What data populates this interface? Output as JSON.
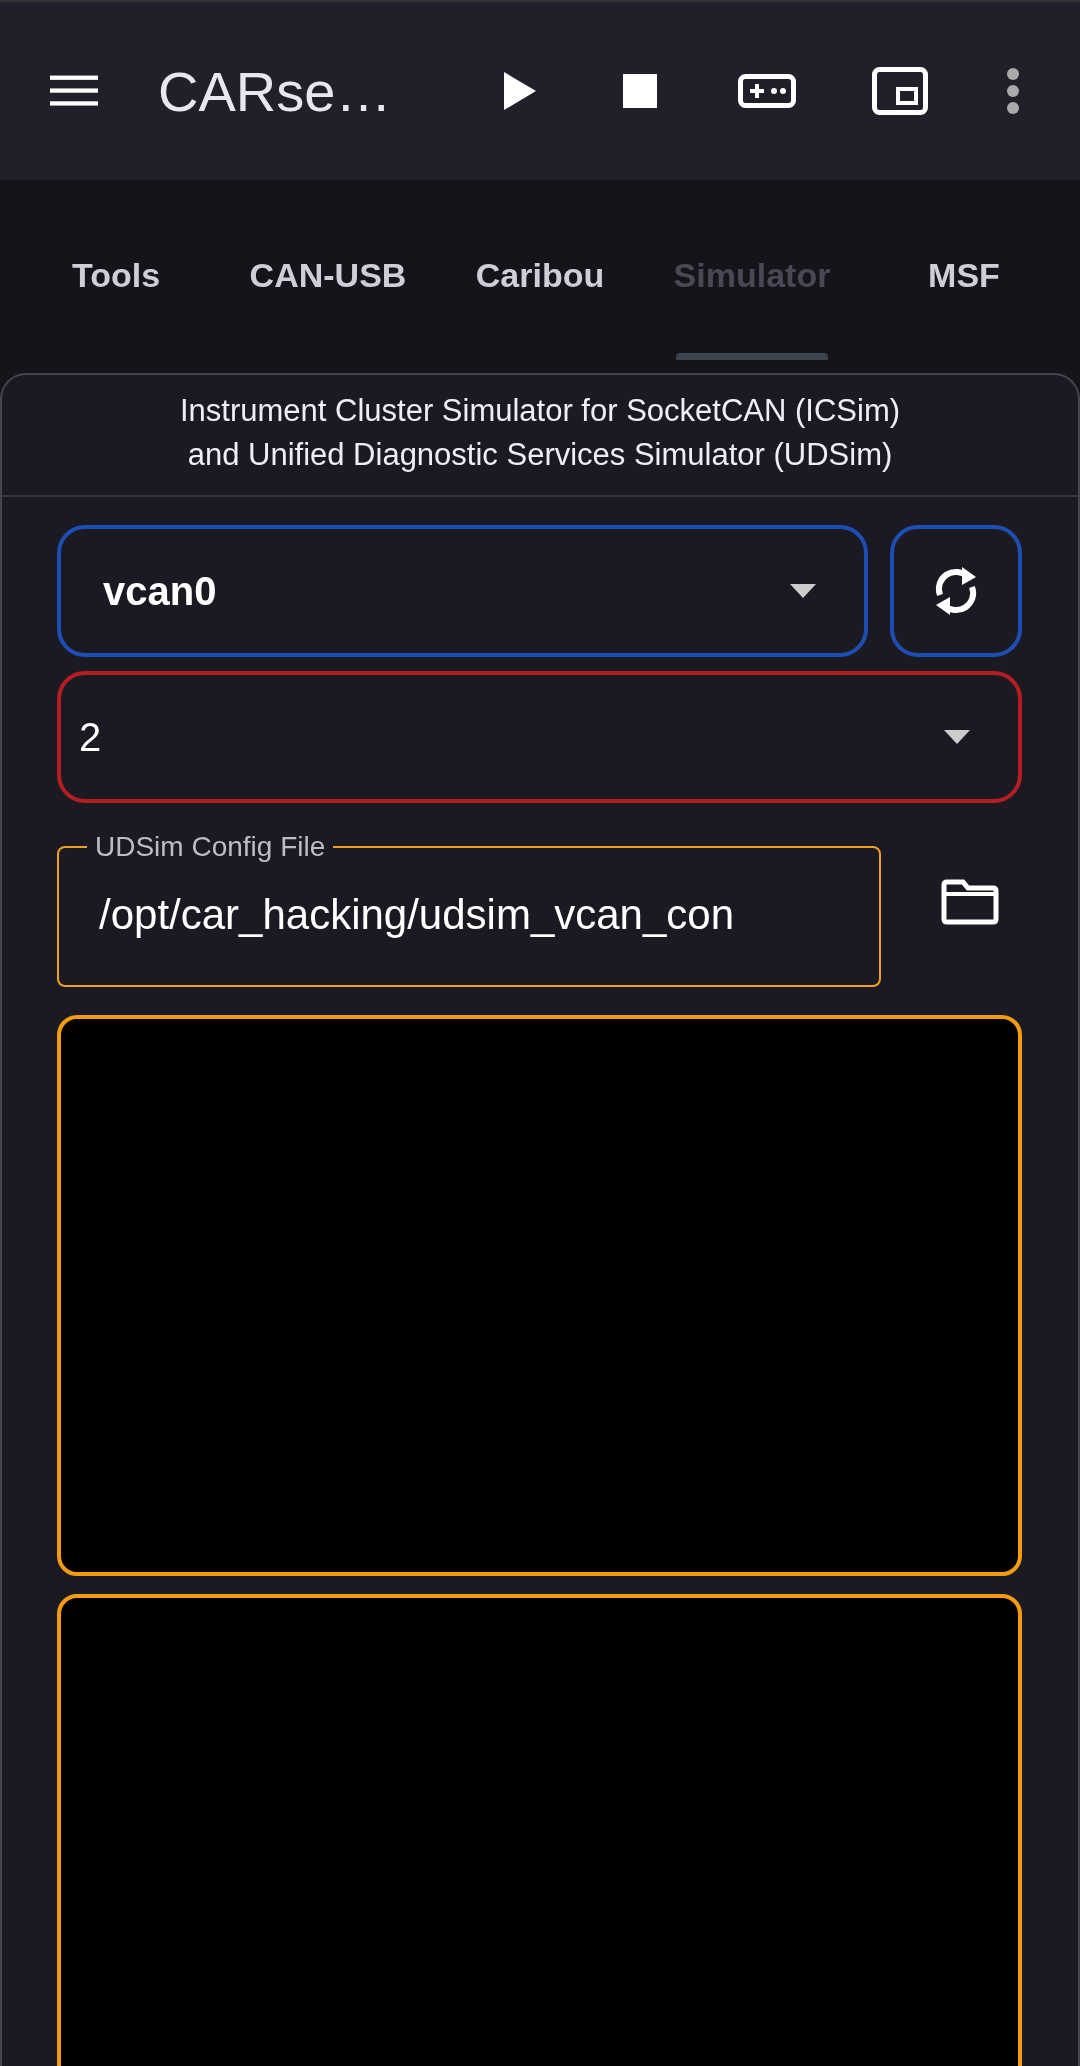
{
  "app_bar": {
    "title": "CARse…"
  },
  "tabs": [
    {
      "label": "Tools",
      "selected": false
    },
    {
      "label": "CAN-USB",
      "selected": false
    },
    {
      "label": "Caribou",
      "selected": false
    },
    {
      "label": "Simulator",
      "selected": true
    },
    {
      "label": "MSF",
      "selected": false
    }
  ],
  "header": "Instrument Cluster Simulator for SocketCAN (ICSim)\nand Unified Diagnostic Services Simulator (UDSim)",
  "interface_spinner": {
    "value": "vcan0"
  },
  "level_spinner": {
    "value": "2"
  },
  "config_field": {
    "label": "UDSim Config File",
    "value": "/opt/car_hacking/udsim_vcan_con"
  },
  "output_panels": [
    {
      "kind": "console"
    },
    {
      "kind": "console"
    }
  ]
}
